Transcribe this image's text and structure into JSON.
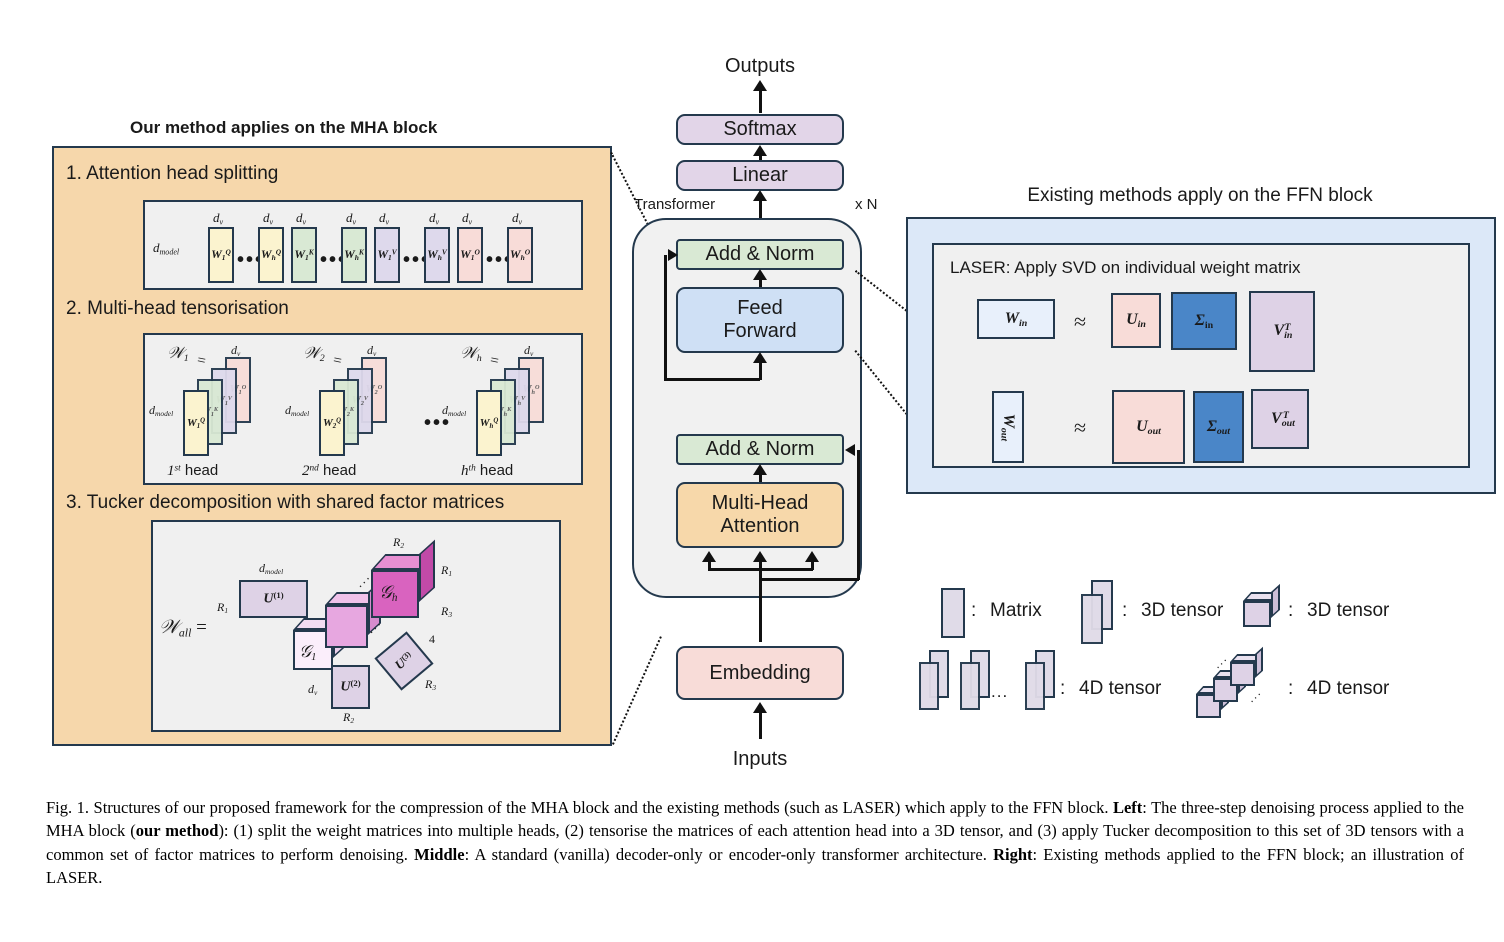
{
  "figure": {
    "left_panel": {
      "heading": "Our method applies on the MHA block",
      "steps": [
        {
          "label": "1. Attention head splitting"
        },
        {
          "label": "2. Multi-head tensorisation"
        },
        {
          "label": "3. Tucker decomposition with shared factor matrices"
        }
      ],
      "step1": {
        "row_label": "d_model",
        "col_label": "d_v",
        "matrices": [
          {
            "name": "W",
            "sub": "1",
            "sup": "Q",
            "color": "#fbf3cf"
          },
          {
            "name": "W",
            "sub": "h",
            "sup": "Q",
            "color": "#fbf3cf"
          },
          {
            "name": "W",
            "sub": "1",
            "sup": "K",
            "color": "#d9e9d4"
          },
          {
            "name": "W",
            "sub": "h",
            "sup": "K",
            "color": "#d9e9d4"
          },
          {
            "name": "W",
            "sub": "1",
            "sup": "V",
            "color": "#ded9ec"
          },
          {
            "name": "W",
            "sub": "h",
            "sup": "V",
            "color": "#ded9ec"
          },
          {
            "name": "W",
            "sub": "1",
            "sup": "O",
            "color": "#f8dcd8"
          },
          {
            "name": "W",
            "sub": "h",
            "sup": "O",
            "color": "#f8dcd8"
          }
        ],
        "ellipsis": "•••"
      },
      "step2": {
        "ellipsis": "•••",
        "row_label": "d_model",
        "col_label": "d_v",
        "groups": [
          {
            "tensor": "W",
            "tensor_sub": "1",
            "eq": "=",
            "caption": "1st head",
            "caption_sup": "st",
            "caption_base": "1",
            "caption_tail": " head",
            "idx": "1"
          },
          {
            "tensor": "W",
            "tensor_sub": "2",
            "eq": "=",
            "caption": "2nd head",
            "caption_sup": "nd",
            "caption_base": "2",
            "caption_tail": " head",
            "idx": "2"
          },
          {
            "tensor": "W",
            "tensor_sub": "h",
            "eq": "=",
            "caption": "hth head",
            "caption_sup": "th",
            "caption_base": "h",
            "caption_tail": " head",
            "idx": "h"
          }
        ],
        "layers": [
          "Q",
          "K",
          "V",
          "O"
        ]
      },
      "step3": {
        "lhs": "W_all =",
        "lhs_base": "W",
        "lhs_sub": "all",
        "u1": "U(1)",
        "u2": "U(2)",
        "u3": "U(3)",
        "core_first": "G1",
        "core_last": "Gh",
        "dims": {
          "d_model": "d_model",
          "d_v": "d_v",
          "R1": "R1",
          "R2": "R2",
          "R3": "R3",
          "four": "4"
        }
      }
    },
    "middle": {
      "output_label": "Outputs",
      "input_label": "Inputs",
      "transformer_label": "Transformer",
      "repeat_label": "x N",
      "blocks": [
        {
          "label": "Softmax",
          "color": "#e2d5e8"
        },
        {
          "label": "Linear",
          "color": "#e2d5e8"
        },
        {
          "label": "Add & Norm",
          "color": "#d9e9d4"
        },
        {
          "label": "Feed Forward",
          "line1": "Feed",
          "line2": "Forward",
          "color": "#cfe0f5"
        },
        {
          "label": "Add & Norm",
          "color": "#d9e9d4"
        },
        {
          "label": "Multi-Head Attention",
          "line1": "Multi-Head",
          "line2": "Attention",
          "color": "#f7d8aa"
        },
        {
          "label": "Embedding",
          "color": "#f8dcd8"
        }
      ]
    },
    "right_panel": {
      "heading": "Existing methods apply on the FFN block",
      "inner_title": "LASER: Apply SVD on individual weight matrix",
      "approx": "≈",
      "rows": [
        {
          "w": {
            "base": "W",
            "sub": "in",
            "color": "#e8f0fb",
            "rotated": false
          },
          "factors": [
            {
              "base": "U",
              "sub": "in",
              "sup": "",
              "color": "#f8dcd8"
            },
            {
              "base": "Σ",
              "sub": "in",
              "sup": "",
              "color": "#4a86c8"
            },
            {
              "base": "V",
              "sub": "in",
              "sup": "T",
              "color": "#ded2e6"
            }
          ]
        },
        {
          "w": {
            "base": "W",
            "sub": "out",
            "color": "#e8f0fb",
            "rotated": true
          },
          "factors": [
            {
              "base": "U",
              "sub": "out",
              "sup": "",
              "color": "#f8dcd8"
            },
            {
              "base": "Σ",
              "sub": "out",
              "sup": "",
              "color": "#4a86c8"
            },
            {
              "base": "V",
              "sub": "out",
              "sup": "T",
              "color": "#ded2e6"
            }
          ]
        }
      ]
    },
    "legend": {
      "sep": ":",
      "ellipsis": "...",
      "items": [
        {
          "id": "matrix",
          "label": "Matrix"
        },
        {
          "id": "3d-tensor-stack",
          "label": "3D tensor"
        },
        {
          "id": "3d-tensor-cube",
          "label": "3D tensor"
        },
        {
          "id": "4d-tensor-stack",
          "label": "4D tensor"
        },
        {
          "id": "4d-tensor-cubes",
          "label": "4D tensor"
        }
      ]
    },
    "caption": {
      "p1": "Fig. 1.  Structures of our proposed framework for the compression of the MHA block and the existing methods (such as LASER) which apply to the FFN block. ",
      "b1": "Left",
      "p2": ": The three-step denoising process applied to the MHA block (",
      "b2": "our method",
      "p3": "): (1) split the weight matrices into multiple heads, (2) tensorise the matrices of each attention head into a 3D tensor, and (3) apply Tucker decomposition to this set of 3D tensors with a common set of factor matrices to perform denoising. ",
      "b3": "Middle",
      "p4": ": A standard (vanilla) decoder-only or encoder-only transformer architecture. ",
      "b4": "Right",
      "p5": ": Existing methods applied to the FFN block; an illustration of LASER."
    },
    "colors": {
      "outline": "#24394d",
      "orange_panel": "#f6d7ab",
      "blue_panel": "#dce8f8",
      "grey_inner": "#f0f0f0",
      "purple": "#e2d5e8",
      "green": "#d9e9d4",
      "blue_block": "#cfe0f5",
      "orange_block": "#f7d8aa",
      "pink": "#f8dcd8",
      "yellow": "#fbf3cf",
      "lilac": "#ded9ec",
      "magenta": "#d963bf",
      "magenta_light": "#e9a8da",
      "sigma_blue": "#4a86c8"
    }
  }
}
